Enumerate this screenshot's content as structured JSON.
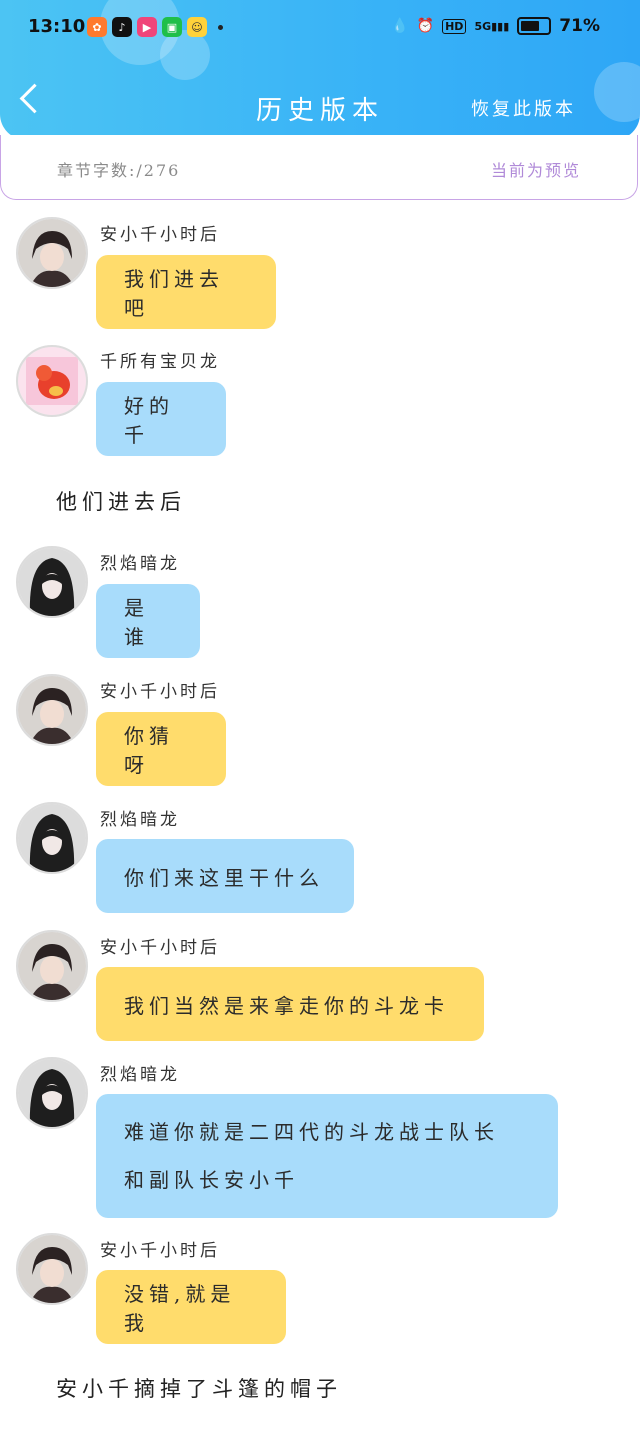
{
  "status_bar": {
    "time": "13:10",
    "network": "5G",
    "hd": "HD",
    "battery_percent": "71%",
    "battery_level": 0.71
  },
  "header": {
    "title": "历史版本",
    "restore_label": "恢复此版本"
  },
  "info": {
    "word_count": "章节字数:/276",
    "preview": "当前为预览"
  },
  "messages": [
    {
      "name": "安小千小时后",
      "text": "我们进去吧"
    },
    {
      "name": "千所有宝贝龙",
      "text": "好的千"
    },
    {
      "narration": "他们进去后"
    },
    {
      "name": "烈焰暗龙",
      "text": "是谁"
    },
    {
      "name": "安小千小时后",
      "text": "你猜呀"
    },
    {
      "name": "烈焰暗龙",
      "text": "你们来这里干什么"
    },
    {
      "name": "安小千小时后",
      "text": "我们当然是来拿走你的斗龙卡"
    },
    {
      "name": "烈焰暗龙",
      "text_line1": "难道你就是二四代的斗龙战士队长",
      "text_line2": "和副队长安小千"
    },
    {
      "name": "安小千小时后",
      "text": "没错,就是我"
    },
    {
      "narration": "安小千摘掉了斗篷的帽子"
    }
  ],
  "colors": {
    "header_blue": "#38b2f7",
    "yellow_bubble": "#ffdc6c",
    "blue_bubble": "#a8dcfb",
    "preview_purple": "#b08ad8"
  }
}
